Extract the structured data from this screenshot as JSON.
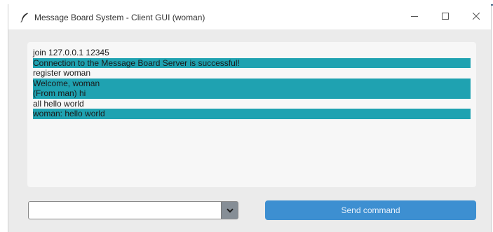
{
  "window": {
    "title": "Message Board System - Client GUI (woman)",
    "icon": "feather-icon",
    "controls": [
      "minimize-icon",
      "maximize-icon",
      "close-icon"
    ]
  },
  "messages": [
    {
      "text": "join 127.0.0.1 12345",
      "highlighted": false
    },
    {
      "text": "Connection to the Message Board Server is successful!",
      "highlighted": true
    },
    {
      "text": "register woman",
      "highlighted": false
    },
    {
      "text": "Welcome, woman",
      "highlighted": true
    },
    {
      "text": "(From man) hi",
      "highlighted": true
    },
    {
      "text": "all hello world",
      "highlighted": false
    },
    {
      "text": "woman: hello world",
      "highlighted": true
    }
  ],
  "command_select": {
    "value": ""
  },
  "send_button": {
    "label": "Send command"
  },
  "colors": {
    "highlight": "#1fa2b1",
    "accent_button": "#3d8fd1",
    "dropdown_arrow_bg": "#868e96"
  }
}
